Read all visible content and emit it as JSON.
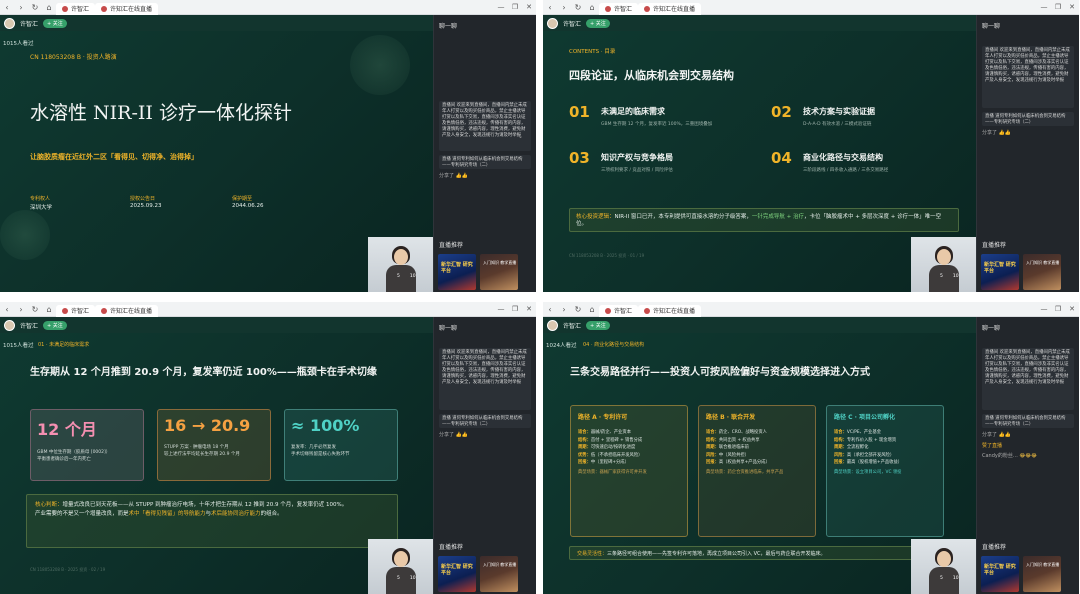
{
  "browser": {
    "tab_label": "许知汇在线直播",
    "nav": [
      "‹",
      "›",
      "↻",
      "⌂"
    ],
    "win_controls": [
      "—",
      "❐",
      "✕"
    ]
  },
  "common": {
    "channel": "许智汇",
    "follow": "+ 关注",
    "chat_title": "聊一聊",
    "recommend": "直播推荐",
    "chat_msg1": "直播间 欢迎来到直播间，直播间内禁止未成年人打赏以及购买低价商品，禁止主播诱导打赏以及私下交易，直播间涉及非实名认证及色情低俗，违法违规，传播有害的内容，请谨慎购买，诱惑内容，理性消费，避免财产及人身安全，发现违规行为请及时举报",
    "chat_msg2": "直播 道何专利如何从临床机会到交易结构——专利研究专场（二）",
    "like": "分享了",
    "promo1": "新华汇智 研究平台",
    "promo2": "入门知识 教学直播",
    "cam_ctrl": [
      "5",
      "10"
    ]
  },
  "slide1": {
    "viewers": "1015人看过",
    "patent_no": "CN 118053208 B · 投资人路演",
    "title": "水溶性 NIR-II 诊疗一体化探针",
    "subtitle": "让脑胶质瘤在近红外二区「看得见、切得净、治得掉」",
    "meta": [
      {
        "label": "专利权人",
        "value": "深圳大学"
      },
      {
        "label": "授权公告日",
        "value": "2025.09.23"
      },
      {
        "label": "保护期至",
        "value": "2044.06.26"
      }
    ]
  },
  "slide2": {
    "contents_label": "CONTENTS · 目录",
    "title": "四段论证，从临床机会到交易结构",
    "items": [
      {
        "num": "01",
        "title": "未满足的临床需求",
        "sub": "GBM 生存期 12 个月，复发率近 100%，三重困境叠加"
      },
      {
        "num": "02",
        "title": "技术方案与实验证据",
        "sub": "D-A-A-D 有效水溶 / 三模式验证链"
      },
      {
        "num": "03",
        "title": "知识产权与竞争格局",
        "sub": "三项权利要求 / 竞品对照 / 风险评估"
      },
      {
        "num": "04",
        "title": "商业化路径与交易结构",
        "sub": "三阶段路线 / 四条收入通路 / 三条交易路径"
      }
    ],
    "logic_label": "核心投资逻辑：",
    "logic_text": "NIR-II 窗口已开，本专利提供可直接水溶的分子级答案，",
    "logic_green": "一针完成导航 + 治疗",
    "logic_text2": "，卡位「脑胶瘤术中 + 多层次深度 + 诊疗一体」唯一空位。",
    "footer": "CN 118053208 B · 2025 投资 · 01 / 19"
  },
  "slide3": {
    "viewers": "1015人看过",
    "breadcrumb": "01 · 未满足的临床需求",
    "title": "生存期从 12 个月推到 20.9 个月，复发率仍近 100%——瓶颈卡在手术切缘",
    "cards": [
      {
        "big": "12 个月",
        "color": "#f48fb1",
        "l1": "GBM 中位生存期（胶质母 [0002]）",
        "l2": "平衡患者确诊后一年内死亡"
      },
      {
        "big": "16 → 20.9",
        "color": "#f5a142",
        "l1": "STUPP 方案 · 肿瘤电场 18 个月",
        "l2": "较上述疗法平均延长生存期 20.9 个月"
      },
      {
        "big": "≈ 100%",
        "color": "#4fd1c5",
        "l1": "复发率：几乎必然复发",
        "l2": "手术切缘残留是核心失败环节"
      }
    ],
    "judge_label": "核心判断：",
    "judge_text": "增量式改良已到天花板——从 STUPP 到肿瘤治疗电场，十年才把生存期从 12 推到 20.9 个月，复发率仍近 100%。",
    "judge_text2": "产业需要的不是又一个增量改良，而是",
    "judge_hl": "术中「看得见残留」的导航能力",
    "judge_text3": "与",
    "judge_hl2": "术后能协同治疗能力",
    "judge_text4": "的组合。",
    "footer": "CN 118053208 B · 2025 投资 · 02 / 19"
  },
  "slide4": {
    "viewers": "1024人看过",
    "breadcrumb": "04 · 商业化路径与交易结构",
    "title": "三条交易路径并行——投资人可按风险偏好与资金规模选择进入方式",
    "paths": [
      {
        "title": "路径 A · 专利许可",
        "color": "#f0b429",
        "lines": [
          [
            "适合：",
            "器械/药企、产业资本"
          ],
          [
            "结构：",
            "首付 + 里程碑 + 销售分成"
          ],
          [
            "周期：",
            "可快速启动/按转化进度"
          ],
          [
            "优势：",
            "低（不承担临床开发风险）"
          ],
          [
            "回报：",
            "中（里程碑+分成）"
          ]
        ],
        "foot": "典型场景：器械厂家获得许可并开发"
      },
      {
        "title": "路径 B · 联合开发",
        "color": "#f0b429",
        "lines": [
          [
            "适合：",
            "药企、CRO、战略投资人"
          ],
          [
            "结构：",
            "共同出资 + 权益共享"
          ],
          [
            "周期：",
            "联合推进临床前"
          ],
          [
            "风险：",
            "中（风险共担）"
          ],
          [
            "回报：",
            "高（权益共享+产品分成）"
          ]
        ],
        "foot": "典型场景：药企合资推进临床，共享产品"
      },
      {
        "title": "路径 C · 项目公司孵化",
        "color": "#4fd1c5",
        "lines": [
          [
            "适合：",
            "VC/PE、产业基金"
          ],
          [
            "结构：",
            "专利作价入股 + 现金增资"
          ],
          [
            "周期：",
            "全流程孵化"
          ],
          [
            "风险：",
            "高（承担全部开发风险）"
          ],
          [
            "回报：",
            "最高（股权增值+产品收益）"
          ]
        ],
        "foot": "典型场景：设立项目公司，VC 领投"
      }
    ],
    "bottom_label": "交易灵活性：",
    "bottom_text": "三条路径可组合使用——先签专利许可落地，再成立项目公司引入 VC，最后与药企联合开发临床。",
    "chat_gift": "赞了直播",
    "chat_gift_user": "Candy的粉丝…"
  }
}
